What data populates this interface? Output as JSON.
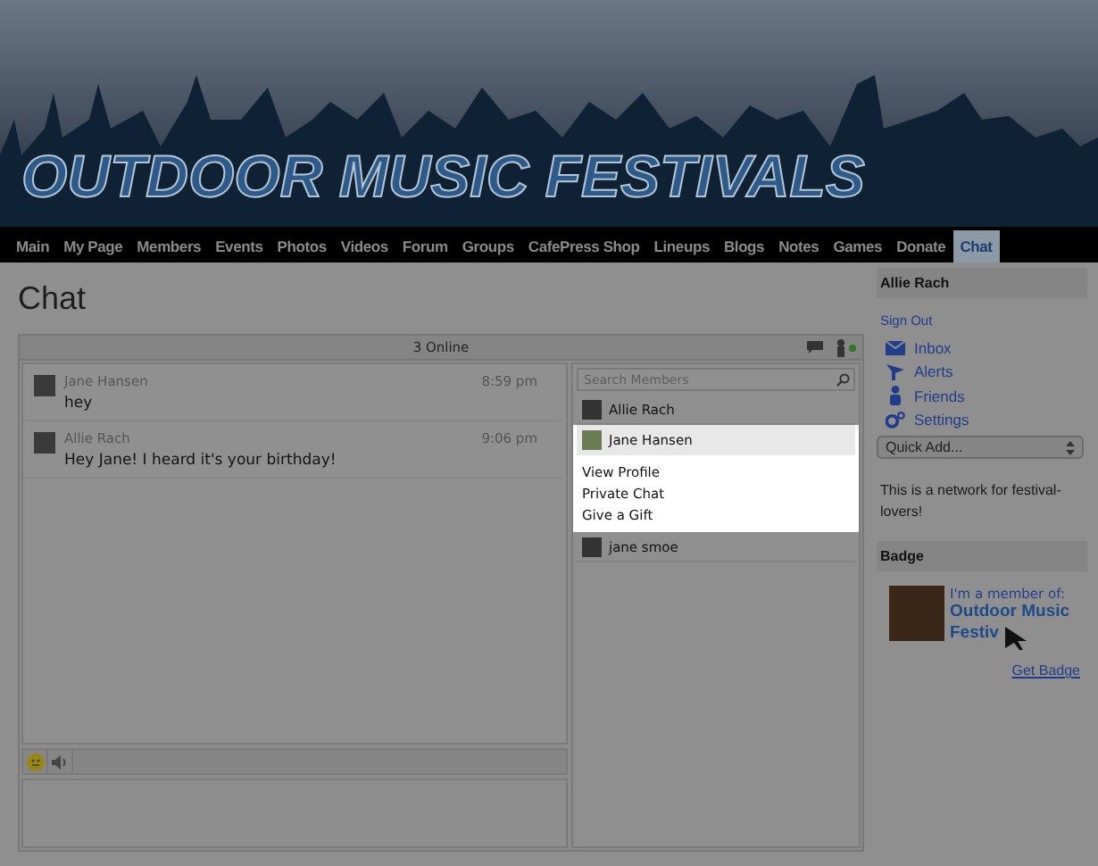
{
  "banner": {
    "title": "OUTDOOR MUSIC FESTIVALS"
  },
  "nav": [
    {
      "label": "Main",
      "selected": false
    },
    {
      "label": "My Page",
      "selected": false
    },
    {
      "label": "Members",
      "selected": false
    },
    {
      "label": "Events",
      "selected": false
    },
    {
      "label": "Photos",
      "selected": false
    },
    {
      "label": "Videos",
      "selected": false
    },
    {
      "label": "Forum",
      "selected": false
    },
    {
      "label": "Groups",
      "selected": false
    },
    {
      "label": "CafePress Shop",
      "selected": false
    },
    {
      "label": "Lineups",
      "selected": false
    },
    {
      "label": "Blogs",
      "selected": false
    },
    {
      "label": "Notes",
      "selected": false
    },
    {
      "label": "Games",
      "selected": false
    },
    {
      "label": "Donate",
      "selected": false
    },
    {
      "label": "Chat",
      "selected": true
    }
  ],
  "page_title": "Chat",
  "chat": {
    "online": "3 Online",
    "messages": [
      {
        "name": "Jane Hansen",
        "time": "8:59 pm",
        "text": "hey"
      },
      {
        "name": "Allie Rach",
        "time": "9:06 pm",
        "text": "Hey Jane! I heard it's your birthday!"
      }
    ],
    "search": {
      "placeholder": "Search Members"
    },
    "members": [
      {
        "name": "Allie Rach",
        "selected": false
      },
      {
        "name": "Jane Hansen",
        "selected": true,
        "menu": [
          "View Profile",
          "Private Chat",
          "Give a Gift"
        ]
      },
      {
        "name": "jane smoe",
        "selected": false
      }
    ]
  },
  "sidebar": {
    "user": "Allie Rach",
    "sign_out": "Sign Out",
    "links": [
      {
        "label": "Inbox",
        "kind": "mail"
      },
      {
        "label": "Alerts",
        "kind": "alert"
      },
      {
        "label": "Friends",
        "kind": "person"
      },
      {
        "label": "Settings",
        "kind": "gear"
      }
    ],
    "quick_add": "Quick Add...",
    "about": "This is a network for festival-lovers!",
    "badge": {
      "heading": "Badge",
      "member_of": "I'm a member of:",
      "network": "Outdoor Music Festiv",
      "get_badge": "Get Badge"
    }
  }
}
